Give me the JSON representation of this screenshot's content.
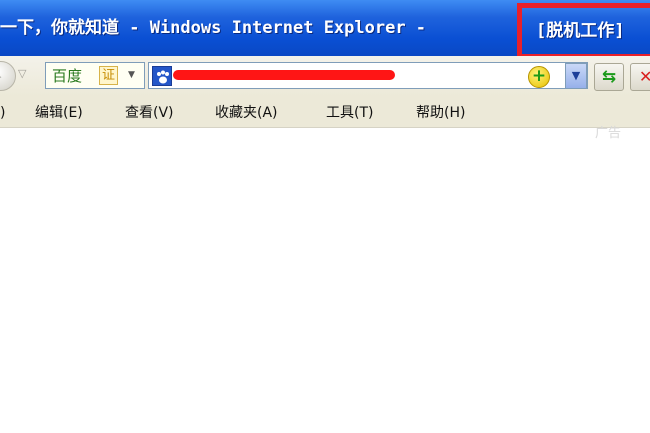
{
  "window": {
    "title": "一下，你就知道 - Windows Internet Explorer - ",
    "offline_tag": "[脱机工作]"
  },
  "toolbar": {
    "search_engine": "百度",
    "search_badge": "证",
    "refresh_icon": "refresh-icon",
    "stop_icon": "stop-icon"
  },
  "menu": {
    "items": [
      ")",
      "编辑(E)",
      "查看(V)",
      "收藏夹(A)",
      "工具(T)",
      "帮助(H)"
    ]
  },
  "content": {
    "ad_label": "广告"
  },
  "colors": {
    "titlebar": "#0a4fd3",
    "highlight_box": "#e8202a",
    "redaction": "#ff1515"
  }
}
